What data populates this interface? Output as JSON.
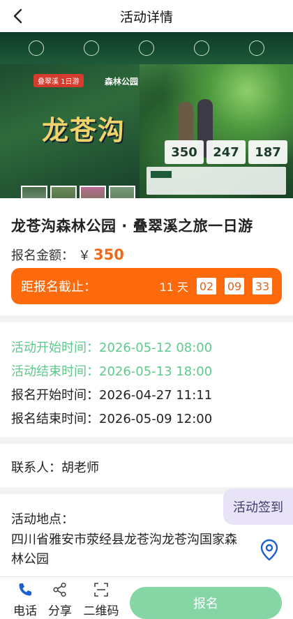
{
  "header": {
    "title": "活动详情",
    "back_icon": "chevron-left-icon"
  },
  "banner": {
    "tag": "叠翠溪 1日游",
    "subtitle": "森林公园",
    "logo": "龙苍沟",
    "prices": [
      "350",
      "247",
      "187"
    ]
  },
  "event": {
    "title": "龙苍沟森林公园 · 叠翠溪之旅一日游",
    "fee_label": "报名金额：",
    "fee_currency": "￥",
    "fee_value": "350"
  },
  "deadline": {
    "label": "距报名截止：",
    "days": "11 天",
    "hours": "02",
    "minutes": "09",
    "seconds": "33"
  },
  "times": {
    "activity_start": "活动开始时间：2026-05-12 08:00",
    "activity_end": "活动结束时间：2026-05-13 18:00",
    "signup_start": "报名开始时间：2026-04-27 11:11",
    "signup_end": "报名结束时间：2026-05-09 12:00"
  },
  "contact": {
    "label": "联系人：胡老师"
  },
  "location": {
    "label": "活动地点：",
    "address": "四川省雅安市荥经县龙苍沟龙苍沟国家森林公园",
    "pin_icon": "location-pin-icon"
  },
  "signin": {
    "label": "活动签到"
  },
  "bottom_bar": {
    "phone_label": "电话",
    "share_label": "分享",
    "qrcode_label": "二维码",
    "register_label": "报名"
  },
  "colors": {
    "accent_orange": "#fd6a0d",
    "price_orange": "#ef6a16",
    "green_text": "#5fc98d",
    "register_green": "#86d5a5",
    "phone_blue": "#1d5fd0",
    "signin_bg": "#e8e3f7"
  }
}
